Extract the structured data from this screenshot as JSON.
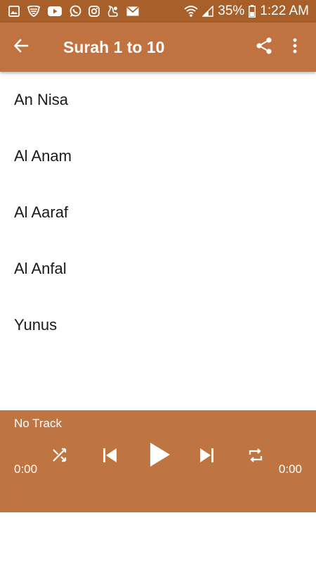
{
  "status_bar": {
    "battery": "35%",
    "time": "1:22 AM",
    "left_icons": [
      "gallery-icon",
      "vpn-shield-icon",
      "youtube-icon",
      "whatsapp-icon",
      "instagram-icon",
      "squirrel-icon",
      "email-icon"
    ],
    "right_icons": [
      "wifi-icon",
      "signal-icon",
      "battery-icon"
    ]
  },
  "app_bar": {
    "title": "Surah 1 to 10",
    "back_icon": "arrow-back-icon",
    "share_icon": "share-icon",
    "menu_icon": "more-vert-icon",
    "color": "#c07340"
  },
  "surah_list": [
    {
      "name": "An Nisa"
    },
    {
      "name": "Al Anam"
    },
    {
      "name": "Al Aaraf"
    },
    {
      "name": "Al Anfal"
    },
    {
      "name": "Yunus"
    }
  ],
  "player": {
    "track": "No Track",
    "elapsed": "0:00",
    "duration": "0:00",
    "progress": 0,
    "controls": [
      "shuffle-icon",
      "skip-previous-icon",
      "play-icon",
      "skip-next-icon",
      "repeat-icon"
    ],
    "color": "#bf7541"
  }
}
